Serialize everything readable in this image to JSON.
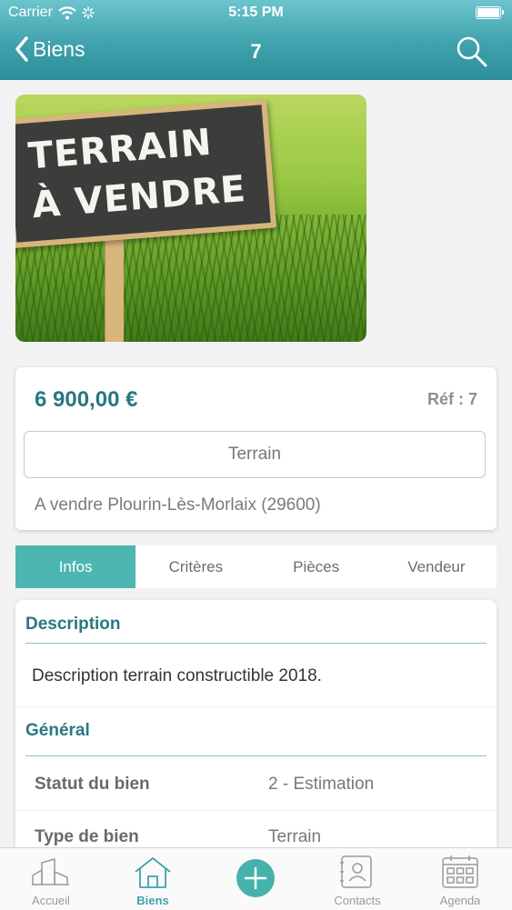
{
  "status_bar": {
    "carrier": "Carrier",
    "time": "5:15 PM"
  },
  "nav": {
    "back_label": "Biens",
    "title": "7"
  },
  "photo": {
    "sign_line1": "TERRAIN",
    "sign_line2": "À VENDRE"
  },
  "summary": {
    "price": "6 900,00 €",
    "ref": "Réf : 7",
    "type": "Terrain",
    "location": "A vendre Plourin-Lès-Morlaix (29600)"
  },
  "tabs": [
    {
      "label": "Infos",
      "active": true
    },
    {
      "label": "Critères",
      "active": false
    },
    {
      "label": "Pièces",
      "active": false
    },
    {
      "label": "Vendeur",
      "active": false
    }
  ],
  "details": {
    "description_title": "Description",
    "description_text": "Description terrain constructible 2018.",
    "general_title": "Général",
    "rows": [
      {
        "label": "Statut du bien",
        "value": "2 - Estimation"
      },
      {
        "label": "Type de bien",
        "value": "Terrain"
      }
    ]
  },
  "tabbar": [
    {
      "label": "Accueil",
      "icon": "home-buildings-icon"
    },
    {
      "label": "Biens",
      "icon": "house-icon",
      "active": true
    },
    {
      "label": "",
      "icon": "add-icon"
    },
    {
      "label": "Contacts",
      "icon": "contacts-icon"
    },
    {
      "label": "Agenda",
      "icon": "calendar-icon"
    }
  ],
  "colors": {
    "accent": "#3fa2ad",
    "tab_active": "#4db6b0",
    "price": "#2a7783"
  }
}
